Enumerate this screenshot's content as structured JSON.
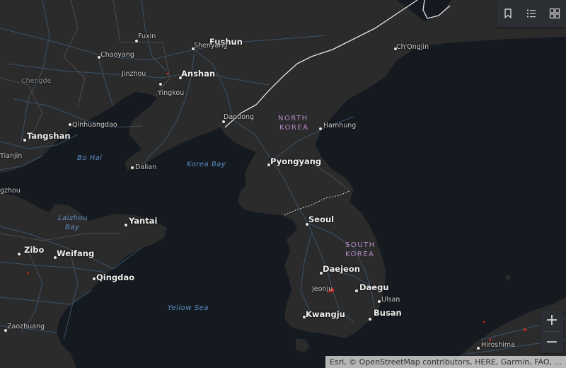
{
  "labels": {
    "fuxin": "Fuxin",
    "fushun": "Fushun",
    "shenyang": "Shenyang",
    "chaoyang": "Chaoyang",
    "jinzhou": "Jinzhou",
    "anshan": "Anshan",
    "chengde": "Chengde",
    "yingkou": "Yingkou",
    "chongjin": "Ch'Ongjin",
    "qinhuangdao": "Qinhuangdao",
    "dandong": "Dandong",
    "tangshan": "Tangshan",
    "tianjin": "Tianjin",
    "bohai": "Bo Hai",
    "dalian": "Dalian",
    "hamhung": "Hamhung",
    "pyongyang": "Pyongyang",
    "koreabay": "Korea Bay",
    "zhou": "gzhou",
    "laizhou1": "Laizhou",
    "laizhou2": "Bay",
    "yantai": "Yantai",
    "seoul": "Seoul",
    "zibo": "Zibo",
    "weifang": "Weifang",
    "qingdao": "Qingdao",
    "daejeon": "Daejeon",
    "jeonju": "Jeonju",
    "daegu": "Daegu",
    "ulsan": "Ulsan",
    "yellowsea": "Yellow Sea",
    "kwangju": "Kwangju",
    "busan": "Busan",
    "zaozhuang": "Zaozhuang",
    "hiroshima": "Hiroshima",
    "northkorea1": "NORTH",
    "northkorea2": "KOREA",
    "southkorea1": "SOUTH",
    "southkorea2": "KOREA"
  },
  "toolbar": {
    "bookmark_icon": "bookmark-icon",
    "layers_icon": "layer-list-icon",
    "basemap_icon": "basemap-gallery-icon"
  },
  "zoom": {
    "in_label": "+",
    "out_label": "−"
  },
  "attribution": "Esri, © OpenStreetMap contributors, HERE, Garmin, FAO, ...",
  "colors": {
    "water": "#151a20",
    "land": "#2b2b2b",
    "roads": "#3d5770",
    "border": "#e6e6e6",
    "water_label": "#5d8fc6",
    "country_label": "#b58bc4",
    "hotspot": "#e0281e"
  }
}
